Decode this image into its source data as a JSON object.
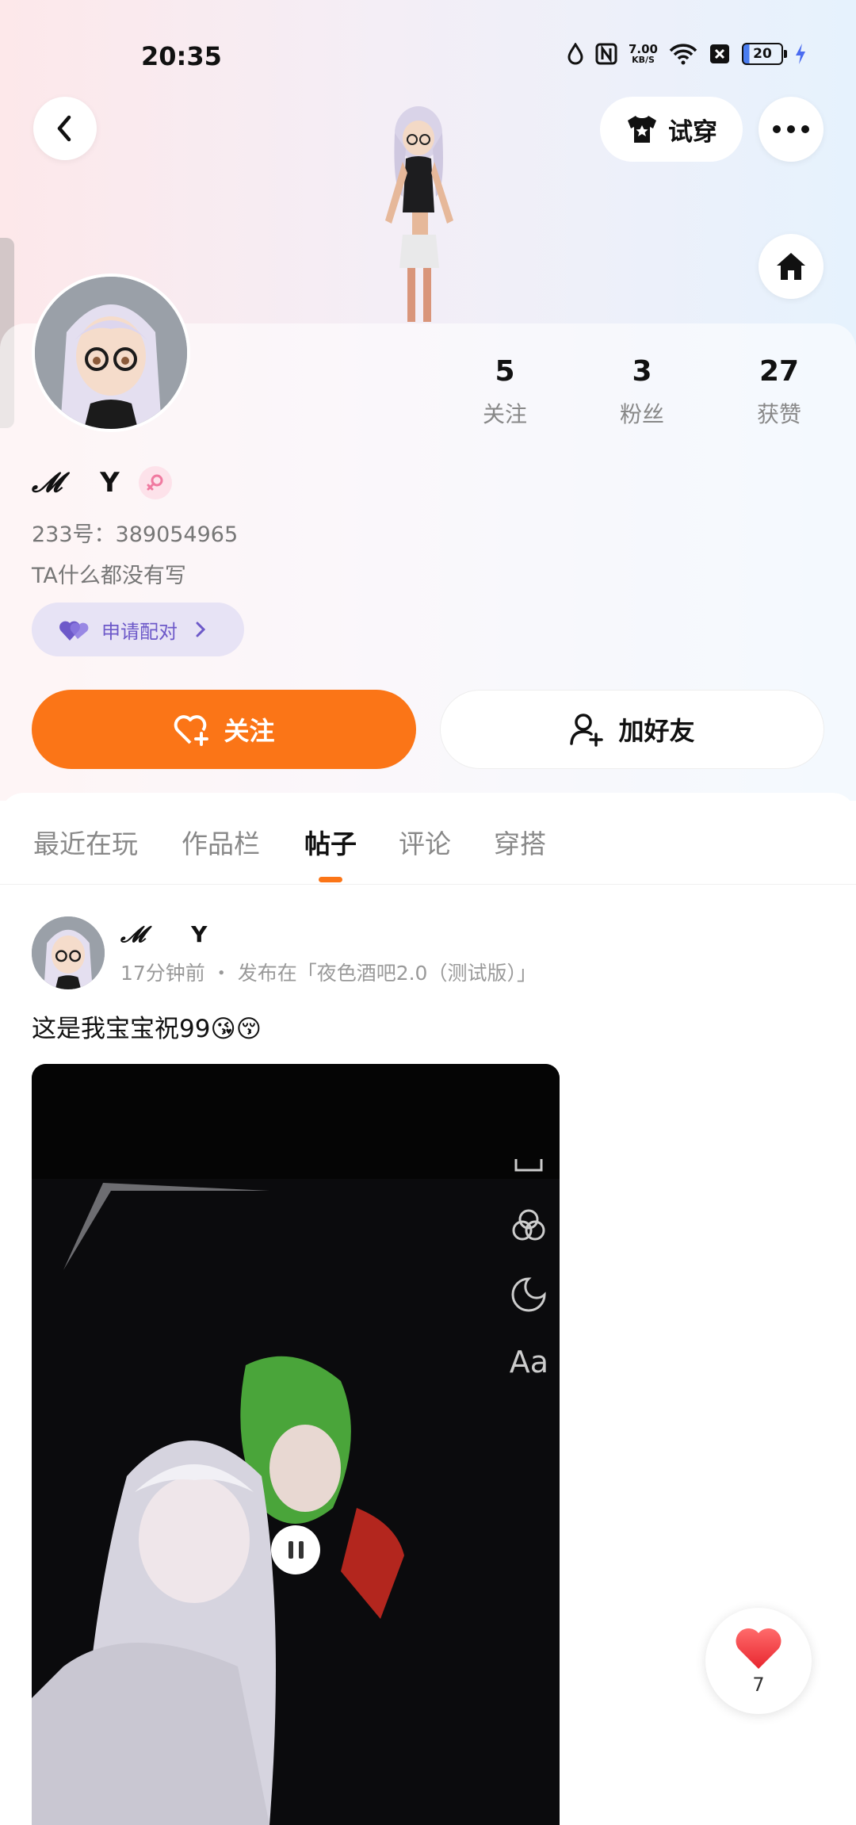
{
  "status_bar": {
    "time": "20:35",
    "net_speed_value": "7.00",
    "net_speed_unit": "KB/S",
    "battery": "20"
  },
  "header": {
    "try_on_label": "试穿",
    "icons": [
      "back-arrow-icon",
      "shirt-icon",
      "more-icon",
      "home-icon"
    ]
  },
  "profile": {
    "stats": [
      {
        "value": "5",
        "label": "关注"
      },
      {
        "value": "3",
        "label": "粉丝"
      },
      {
        "value": "27",
        "label": "获赞"
      }
    ],
    "name_prefix": "𝓜",
    "name": "Y",
    "id_text": "233号：389054965",
    "bio": "TA什么都没有写",
    "pair_label": "申请配对"
  },
  "actions": {
    "follow_label": "关注",
    "add_friend_label": "加好友",
    "follow_color": "#fb7517"
  },
  "tabs": [
    {
      "label": "最近在玩",
      "active": false
    },
    {
      "label": "作品栏",
      "active": false
    },
    {
      "label": "帖子",
      "active": true
    },
    {
      "label": "评论",
      "active": false
    },
    {
      "label": "穿搭",
      "active": false
    }
  ],
  "post": {
    "author_prefix": "𝓜",
    "author": "Y",
    "meta": "17分钟前 ・ 发布在「夜色酒吧2.0（测试版）」",
    "text": "这是我宝宝祝99😘😚",
    "video_tools": [
      "Aa"
    ]
  },
  "like": {
    "count": "7"
  }
}
